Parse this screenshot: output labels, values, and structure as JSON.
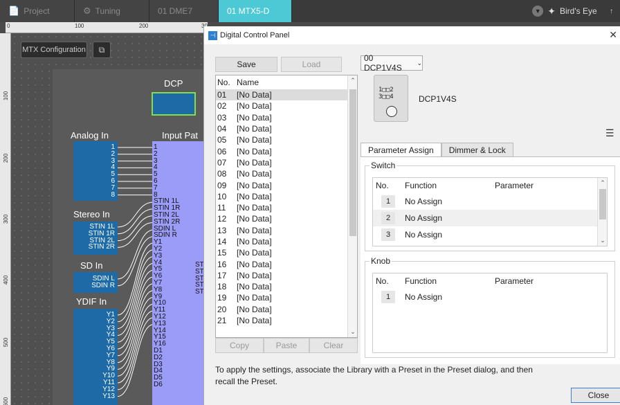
{
  "tabs": [
    {
      "label": "Project",
      "icon": "document-icon"
    },
    {
      "label": "Tuning",
      "icon": "tuning-icon"
    },
    {
      "label": "01 DME7",
      "icon": ""
    },
    {
      "label": "01 MTX5-D",
      "icon": ""
    }
  ],
  "birdseye": {
    "label": "Bird's Eye"
  },
  "ruler": {
    "top": [
      "0",
      "100",
      "200",
      "30"
    ],
    "left": [
      "100",
      "200",
      "300",
      "400",
      "500",
      "600"
    ]
  },
  "canvas": {
    "mtx_config_label": "MTX Configuration",
    "dcp_label": "DCP",
    "analog_in": {
      "title": "Analog In",
      "pins": [
        "1",
        "2",
        "3",
        "4",
        "5",
        "6",
        "7",
        "8"
      ]
    },
    "stereo_in": {
      "title": "Stereo In",
      "pins": [
        "STIN 1L",
        "STIN 1R",
        "STIN 2L",
        "STIN 2R"
      ]
    },
    "sd_in": {
      "title": "SD In",
      "pins": [
        "SDIN L",
        "SDIN R"
      ]
    },
    "ydif_in": {
      "title": "YDIF In",
      "pins": [
        "Y1",
        "Y2",
        "Y3",
        "Y4",
        "Y5",
        "Y6",
        "Y7",
        "Y8",
        "Y9",
        "Y10",
        "Y11",
        "Y12",
        "Y13"
      ]
    },
    "input_patch": {
      "title": "Input Pat",
      "pins": [
        "1",
        "2",
        "3",
        "4",
        "5",
        "6",
        "7",
        "8",
        "STIN 1L",
        "STIN 1R",
        "STIN 2L",
        "STIN 2R",
        "SDIN L",
        "SDIN R",
        "Y1",
        "Y2",
        "Y3",
        "Y4",
        "Y5",
        "Y6",
        "Y7",
        "Y8",
        "Y9",
        "Y10",
        "Y11",
        "Y12",
        "Y13",
        "Y14",
        "Y15",
        "Y16",
        "D1",
        "D2",
        "D3",
        "D4",
        "D5",
        "D6"
      ]
    },
    "st_pins": [
      "ST",
      "ST",
      "ST",
      "ST",
      "ST"
    ]
  },
  "dialog": {
    "title": "Digital Control Panel",
    "save_label": "Save",
    "load_label": "Load",
    "copy_label": "Copy",
    "paste_label": "Paste",
    "clear_label": "Clear",
    "list_headers": {
      "no": "No.",
      "name": "Name"
    },
    "list_rows": [
      {
        "no": "01",
        "name": "[No Data]"
      },
      {
        "no": "02",
        "name": "[No Data]"
      },
      {
        "no": "03",
        "name": "[No Data]"
      },
      {
        "no": "04",
        "name": "[No Data]"
      },
      {
        "no": "05",
        "name": "[No Data]"
      },
      {
        "no": "06",
        "name": "[No Data]"
      },
      {
        "no": "07",
        "name": "[No Data]"
      },
      {
        "no": "08",
        "name": "[No Data]"
      },
      {
        "no": "09",
        "name": "[No Data]"
      },
      {
        "no": "10",
        "name": "[No Data]"
      },
      {
        "no": "11",
        "name": "[No Data]"
      },
      {
        "no": "12",
        "name": "[No Data]"
      },
      {
        "no": "13",
        "name": "[No Data]"
      },
      {
        "no": "14",
        "name": "[No Data]"
      },
      {
        "no": "15",
        "name": "[No Data]"
      },
      {
        "no": "16",
        "name": "[No Data]"
      },
      {
        "no": "17",
        "name": "[No Data]"
      },
      {
        "no": "18",
        "name": "[No Data]"
      },
      {
        "no": "19",
        "name": "[No Data]"
      },
      {
        "no": "20",
        "name": "[No Data]"
      },
      {
        "no": "21",
        "name": "[No Data]"
      }
    ],
    "device_select": "00 DCP1V4S",
    "device_name": "DCP1V4S",
    "device_labels": [
      "1□□2",
      "3□□4"
    ],
    "tabs": [
      {
        "label": "Parameter Assign"
      },
      {
        "label": "Dimmer & Lock"
      }
    ],
    "switch": {
      "title": "Switch",
      "headers": {
        "no": "No.",
        "function": "Function",
        "parameter": "Parameter"
      },
      "rows": [
        {
          "no": "1",
          "function": "No Assign",
          "parameter": ""
        },
        {
          "no": "2",
          "function": "No Assign",
          "parameter": ""
        },
        {
          "no": "3",
          "function": "No Assign",
          "parameter": ""
        }
      ]
    },
    "knob": {
      "title": "Knob",
      "headers": {
        "no": "No.",
        "function": "Function",
        "parameter": "Parameter"
      },
      "rows": [
        {
          "no": "1",
          "function": "No Assign",
          "parameter": ""
        }
      ]
    },
    "note": "To apply the settings, associate the Library with a Preset in the Preset dialog, and then recall the Preset.",
    "close_label": "Close"
  }
}
